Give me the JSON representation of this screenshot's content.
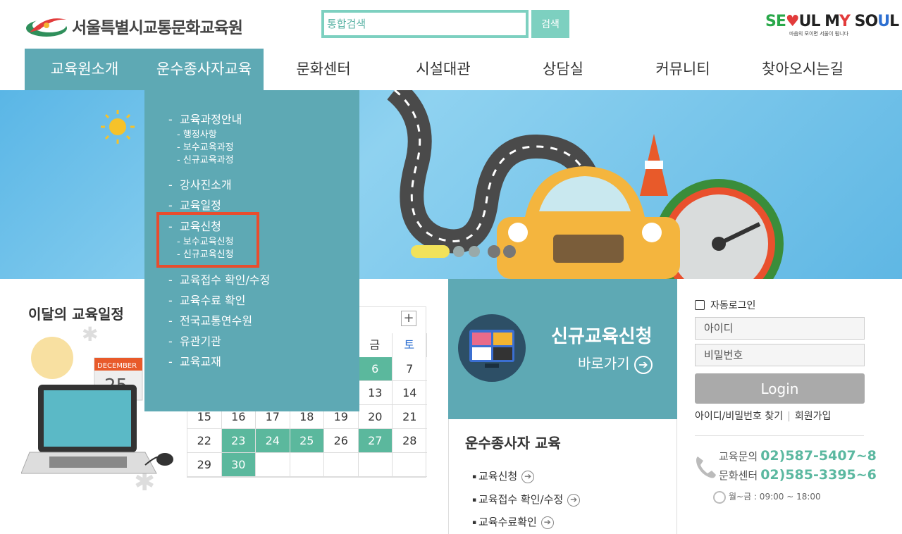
{
  "header": {
    "logo_text": "서울특별시교통문화교육원",
    "search_placeholder": "통합검색",
    "search_button": "검색",
    "slogan": {
      "part1": "SE",
      "heart": "♥",
      "part2": "UL M",
      "y": "Y",
      "part3": " SO",
      "u": "U",
      "part4": "L",
      "sub": "마음의 모이면 서울이 됩니다"
    }
  },
  "nav": {
    "items": [
      {
        "label": "교육원소개",
        "active": true
      },
      {
        "label": "운수종사자교육",
        "active": true
      },
      {
        "label": "문화센터"
      },
      {
        "label": "시설대관"
      },
      {
        "label": "상담실"
      },
      {
        "label": "커뮤니티"
      },
      {
        "label": "찾아오시는길"
      }
    ]
  },
  "dropdown": {
    "items": [
      {
        "label": "교육과정안내",
        "subs": [
          "행정사항",
          "보수교육과정",
          "신규교육과정"
        ]
      },
      {
        "label": "강사진소개"
      },
      {
        "label": "교육일정"
      },
      {
        "label": "교육신청",
        "subs": [
          "보수교육신청",
          "신규교육신청"
        ],
        "highlighted": true
      },
      {
        "label": "교육접수 확인/수정"
      },
      {
        "label": "교육수료 확인"
      },
      {
        "label": "전국교통연수원"
      },
      {
        "label": "유관기관"
      },
      {
        "label": "교육교재"
      }
    ]
  },
  "schedule": {
    "title": "이달의 교육일정",
    "calendar_label": "DECEMBER",
    "calendar_day": "25",
    "plus": "+",
    "weekday_header": [
      "금",
      "토"
    ],
    "rows": [
      [
        null,
        null,
        null,
        null,
        null,
        "6",
        "7"
      ],
      [
        null,
        null,
        null,
        null,
        null,
        "13",
        "14"
      ],
      [
        "15",
        "16",
        "17",
        "18",
        "19",
        "20",
        "21"
      ],
      [
        "22",
        "23",
        "24",
        "25",
        "26",
        "27",
        "28"
      ],
      [
        "29",
        "30",
        null,
        null,
        null,
        null,
        null
      ]
    ],
    "highlighted_days": [
      "6",
      "23",
      "24",
      "25",
      "27",
      "30"
    ]
  },
  "new_education": {
    "title": "신규교육신청",
    "link": "바로가기"
  },
  "transit_education": {
    "title": "운수종사자 교육",
    "links": [
      "교육신청",
      "교육접수 확인/수정",
      "교육수료확인"
    ]
  },
  "login": {
    "auto_login": "자동로그인",
    "id_placeholder": "아이디",
    "pw_placeholder": "비밀번호",
    "button": "Login",
    "find_link": "아이디/비밀번호 찾기",
    "join_link": "회원가입"
  },
  "contact": {
    "edu_label": "교육문의",
    "edu_number": "02)587-5407~8",
    "culture_label": "문화센터",
    "culture_number": "02)585-3395~6",
    "hours": "월~금 : 09:00 ~ 18:00"
  },
  "colors": {
    "teal": "#5ea9b4",
    "mint": "#7dd0c0",
    "green": "#5bb89d",
    "highlight": "#e84d2e"
  }
}
